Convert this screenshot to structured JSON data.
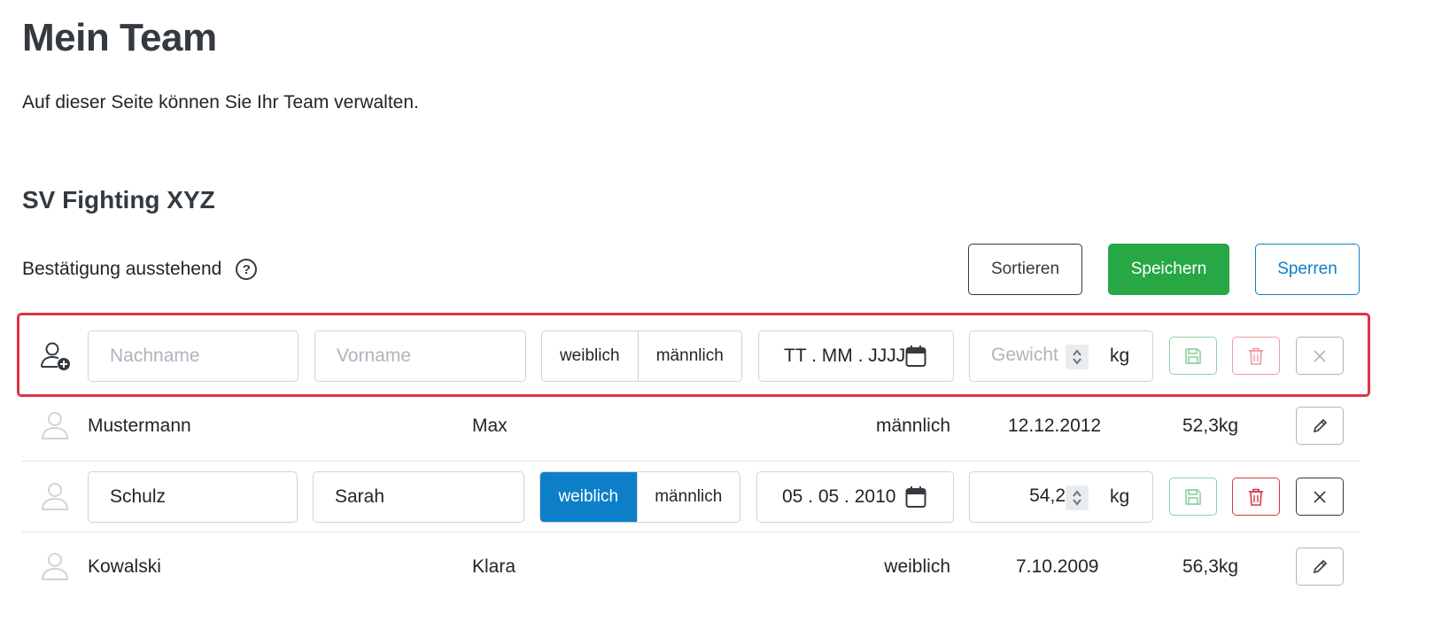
{
  "page": {
    "title": "Mein Team",
    "description": "Auf dieser Seite können Sie Ihr Team verwalten."
  },
  "team": {
    "name": "SV Fighting XYZ",
    "pending_label": "Bestätigung ausstehend",
    "help_icon": "?"
  },
  "toolbar": {
    "sort_label": "Sortieren",
    "save_label": "Speichern",
    "lock_label": "Sperren"
  },
  "new_member": {
    "lastname_placeholder": "Nachname",
    "firstname_placeholder": "Vorname",
    "gender_options": [
      "weiblich",
      "männlich"
    ],
    "date_placeholder": "TT . MM . JJJJ",
    "weight_placeholder": "Gewicht",
    "weight_unit": "kg"
  },
  "members": [
    {
      "lastname": "Mustermann",
      "firstname": "Max",
      "gender": "männlich",
      "birthdate": "12.12.2012",
      "weight": "52,3kg"
    },
    {
      "lastname": "Schulz",
      "firstname": "Sarah",
      "gender": "weiblich",
      "birthdate": "05 . 05 . 2010",
      "weight": "54,2",
      "weight_unit": "kg",
      "gender_options": [
        "weiblich",
        "männlich"
      ]
    },
    {
      "lastname": "Kowalski",
      "firstname": "Klara",
      "gender": "weiblich",
      "birthdate": "7.10.2009",
      "weight": "56,3kg"
    }
  ],
  "colors": {
    "accent_blue": "#0d7fc9",
    "success_green": "#28a745",
    "danger_red": "#dc3545"
  },
  "icons": {
    "add_user": "add-user-icon",
    "person": "person-icon",
    "calendar": "calendar-icon",
    "save": "floppy-disk-icon",
    "delete": "trash-icon",
    "close": "close-icon",
    "edit": "pencil-icon",
    "spinner": "spinner-icon"
  }
}
